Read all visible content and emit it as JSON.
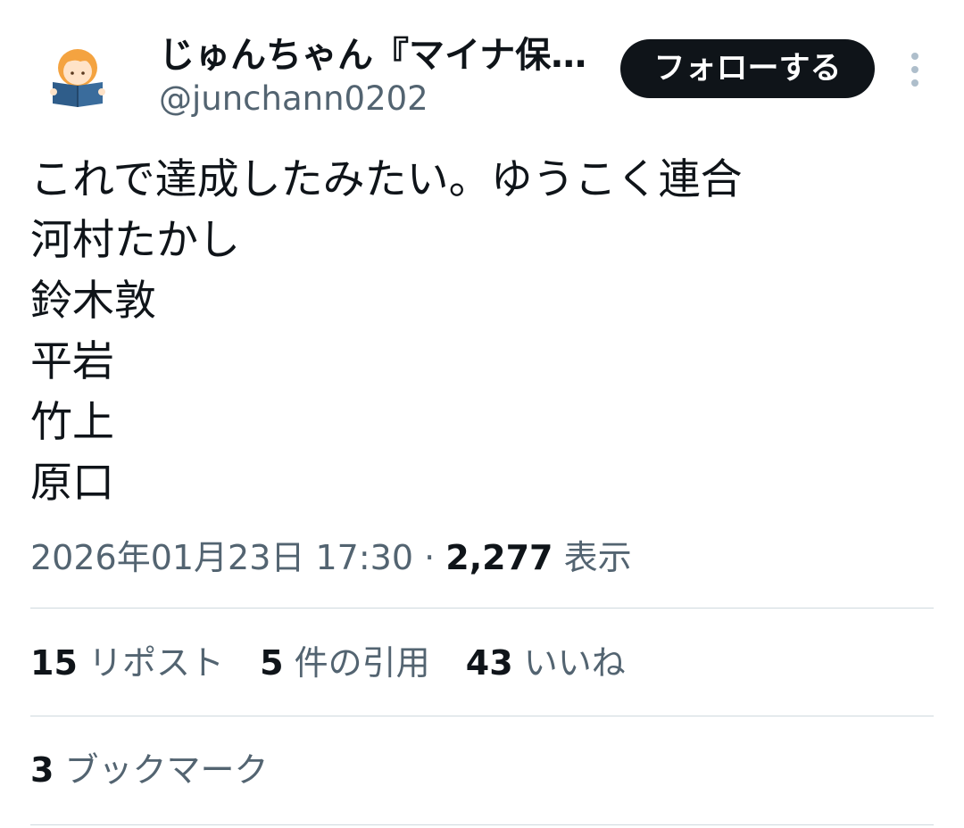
{
  "author": {
    "display_name": "じゅんちゃん『マイナ保…",
    "handle": "@junchann0202",
    "avatar_icon": "reading-person-avatar-icon"
  },
  "header": {
    "follow_label": "フォローする",
    "more_icon": "vertical-ellipsis-icon"
  },
  "tweet": {
    "lines": [
      "これで達成したみたい。ゆうこく連合",
      "河村たかし",
      "鈴木敦",
      "平岩",
      "竹上",
      "原口"
    ]
  },
  "meta": {
    "timestamp": "2026年01月23日 17:30",
    "separator": "·",
    "views_count": "2,277",
    "views_label": "表示"
  },
  "stats": {
    "reposts_count": "15",
    "reposts_label": "リポスト",
    "quotes_count": "5",
    "quotes_label": "件の引用",
    "likes_count": "43",
    "likes_label": "いいね"
  },
  "bookmarks": {
    "count": "3",
    "label": "ブックマーク"
  },
  "colors": {
    "text_primary": "#0f1419",
    "text_secondary": "#536471",
    "divider": "#cfd9de",
    "follow_button_bg": "#0f1419",
    "avatar_hair": "#f4a340",
    "avatar_book": "#2f5d8a"
  }
}
